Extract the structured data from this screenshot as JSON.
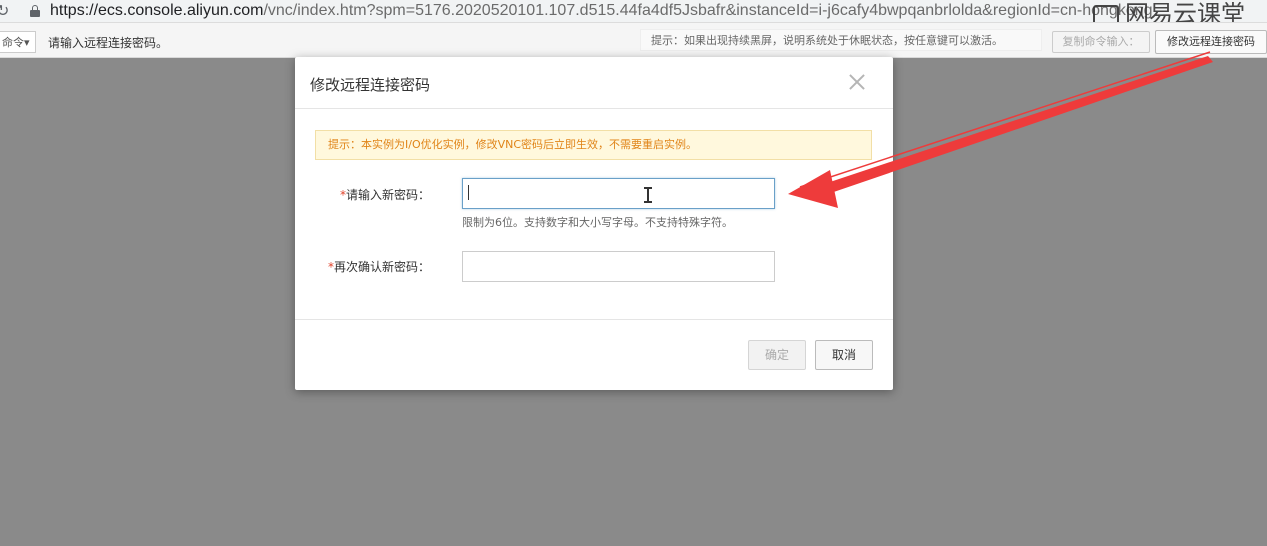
{
  "browser": {
    "url_host": "https://ecs.console.aliyun.com",
    "url_path": "/vnc/index.htm?spm=5176.2020520101.107.d515.44fa4df5Jsbafr&instanceId=i-j6cafy4bwpqanbrlolda&regionId=cn-hongkong",
    "watermark": "网易云课堂"
  },
  "toolbar": {
    "cmd_dropdown": "命令",
    "message": "请输入远程连接密码。",
    "hint": "提示：如果出现持续黑屏，说明系统处于休眠状态，按任意键可以激活。",
    "copy_cmd_label": "复制命令输入：",
    "modify_pw_label": "修改远程连接密码"
  },
  "modal": {
    "title": "修改远程连接密码",
    "notice": "提示：本实例为I/O优化实例，修改VNC密码后立即生效，不需要重启实例。",
    "new_pw": {
      "required": "*",
      "label": "请输入新密码：",
      "value": "",
      "help": "限制为6位。支持数字和大小写字母。不支持特殊字符。"
    },
    "confirm_pw": {
      "required": "*",
      "label": "再次确认新密码：",
      "value": ""
    },
    "ok_label": "确定",
    "cancel_label": "取消"
  },
  "colors": {
    "overlay": "#8a8a8a",
    "notice_text": "#e08418",
    "notice_bg": "#fff8dd",
    "required": "#e0432b",
    "arrow": "#ee3b3b"
  }
}
